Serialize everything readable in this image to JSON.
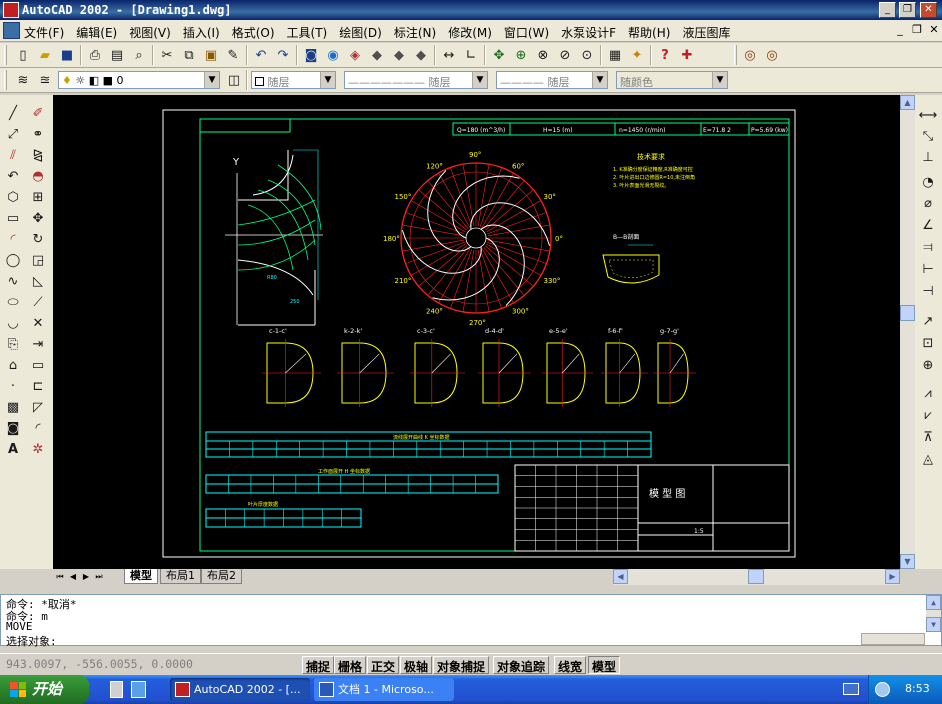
{
  "window": {
    "title": "AutoCAD 2002 - [Drawing1.dwg]",
    "min_glyph": "_",
    "max_glyph": "❐",
    "close_glyph": "✕"
  },
  "menu": {
    "items": [
      "文件(F)",
      "编辑(E)",
      "视图(V)",
      "插入(I)",
      "格式(O)",
      "工具(T)",
      "绘图(D)",
      "标注(N)",
      "修改(M)",
      "窗口(W)",
      "水泵设计F",
      "帮助(H)",
      "液压图库"
    ],
    "doc_min": "_",
    "doc_restore": "❐",
    "doc_close": "✕"
  },
  "properties_bar": {
    "layer_combo": "0",
    "color_combo": "随层",
    "linetype_combo": "随层",
    "lineweight_combo": "随层",
    "plotstyle_combo": "随颜色"
  },
  "tabs": {
    "model": "模型",
    "layout1": "布局1",
    "layout2": "布局2"
  },
  "command": {
    "lines": [
      "命令: *取消*",
      "命令: m",
      "MOVE",
      "选择对象:"
    ]
  },
  "status": {
    "coords": "943.0097, -556.0055, 0.0000",
    "buttons": [
      "捕捉",
      "栅格",
      "正交",
      "极轴",
      "对象捕捉",
      "对象追踪",
      "线宽",
      "模型"
    ]
  },
  "taskbar": {
    "start": "开始",
    "items": [
      "AutoCAD 2002 - [...",
      "文档 1 - Microso..."
    ],
    "clock": "8:53"
  },
  "drawing": {
    "header_cells": [
      "Q=180 (m^3/h)",
      "H=15 (m)",
      "n=1450 (r/min)",
      "E=71.8 2",
      "P=5.69 (kw)"
    ],
    "angle_labels": [
      "90°",
      "120°",
      "60°",
      "150°",
      "30°",
      "180°",
      "0°",
      "210°",
      "330°",
      "240°",
      "270°",
      "300°"
    ],
    "y_label": "Y",
    "tech_title": "技术要求",
    "tech_lines": [
      "1. K准确分度保证精度,R准确度可控",
      "2. 叶片进出口边修圆R=10,未注倒角",
      "3. 叶片表面光滑无裂纹。"
    ],
    "section_title": "B—B剖面",
    "profile_labels": [
      "c-1-c'",
      "k-2-k'",
      "c-3-c'",
      "d-4-d'",
      "e-5-e'",
      "f-6-f'",
      "g-7-g'"
    ],
    "table1_title": "流线展开曲线 K 坐标数据",
    "table2_title": "工作面展开 H 坐标数据",
    "table3_title": "叶片厚度数据",
    "title_block_name": "模 型 图",
    "title_block_scale": "1:5"
  }
}
